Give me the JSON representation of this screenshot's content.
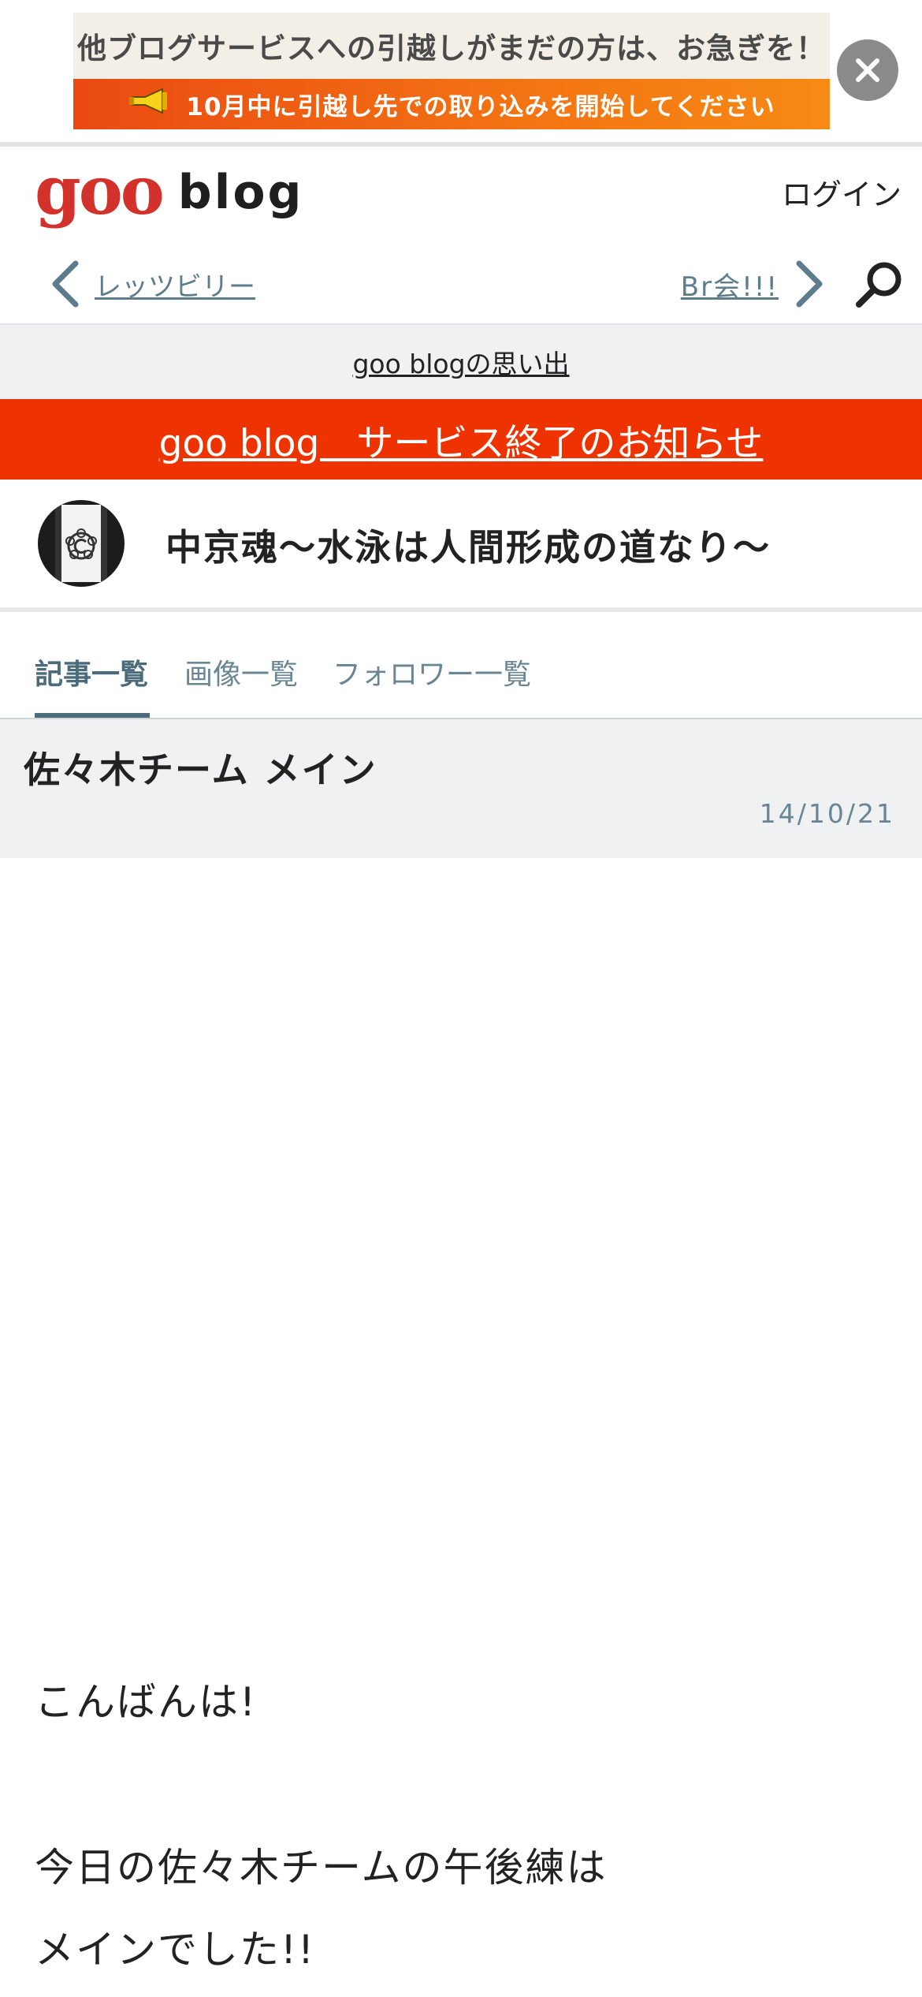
{
  "ad": {
    "line1": "他ブログサービスへの引越しがまだの方は、お急ぎを！",
    "line2": "10月中に引越し先での取り込みを開始してください",
    "close_icon": "close-icon"
  },
  "header": {
    "logo_goo": "goo",
    "logo_blog": "blog",
    "login": "ログイン"
  },
  "pager": {
    "prev": "レッツビリー",
    "next": "Br会!!!"
  },
  "memories_link": "goo blogの思い出",
  "notice_link": "goo blog　サービス終了のお知らせ",
  "blog": {
    "title": "中京魂～水泳は人間形成の道なり～"
  },
  "tabs": [
    {
      "label": "記事一覧"
    },
    {
      "label": "画像一覧"
    },
    {
      "label": "フォロワー一覧"
    }
  ],
  "article": {
    "title": "佐々木チーム メイン",
    "date": "14/10/21",
    "body": [
      "こんばんは!",
      "今日の佐々木チームの午後練は",
      "メインでした!!"
    ]
  },
  "colors": {
    "accent_red": "#ee3300",
    "logo_red": "#d2322b",
    "link_gray": "#5d7d8c"
  }
}
